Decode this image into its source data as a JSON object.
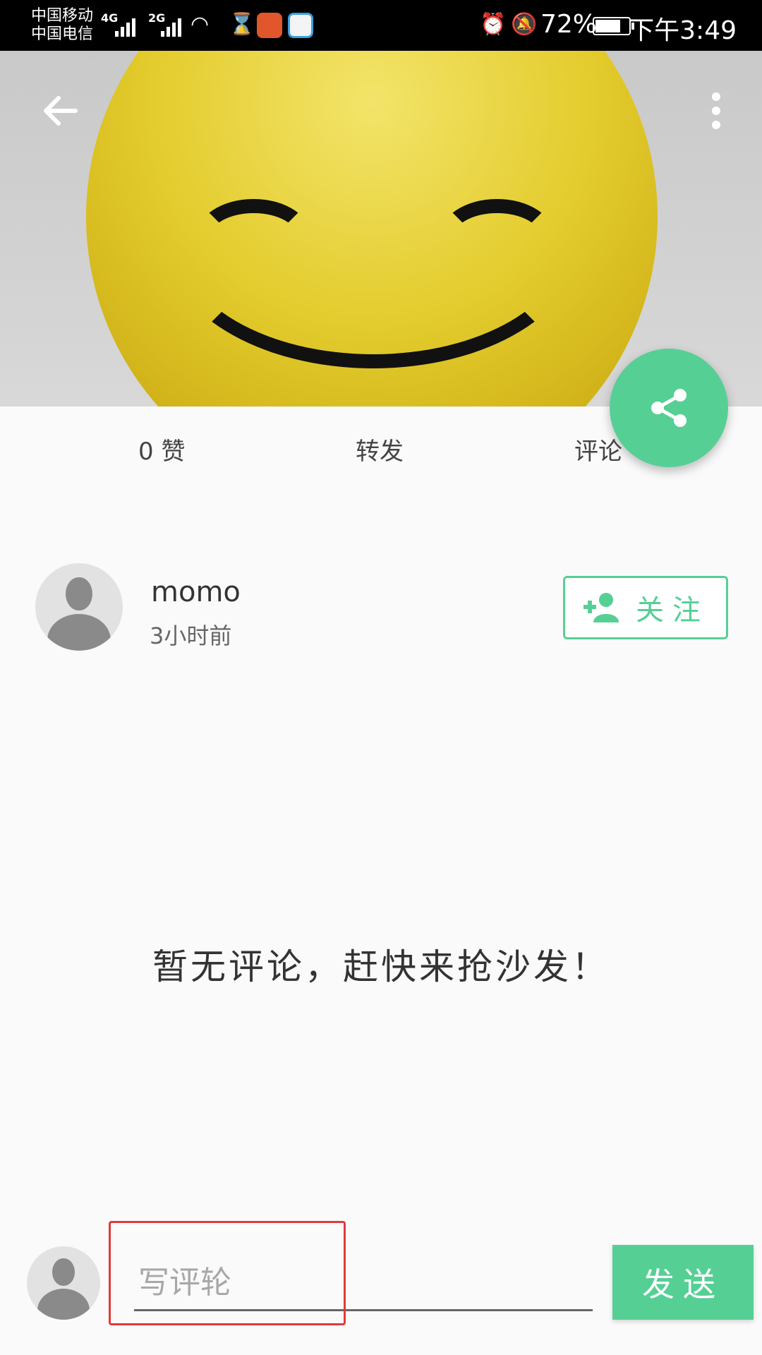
{
  "status_bar": {
    "carrier_1": "中国移动",
    "carrier_2": "中国电信",
    "net_1": "4G",
    "net_2": "2G",
    "battery": "72%",
    "time": "下午3:49"
  },
  "header": {
    "icons": {
      "back": "arrow-left-icon",
      "more": "more-vertical-icon",
      "share": "share-icon"
    }
  },
  "stats": {
    "likes": "0 赞",
    "repost": "转发",
    "comments": "评论"
  },
  "author": {
    "name": "momo",
    "time": "3小时前",
    "follow_label": "关注"
  },
  "comments": {
    "empty_message": "暂无评论，赶快来抢沙发！"
  },
  "composer": {
    "placeholder": "写评轮",
    "send_label": "发送"
  },
  "colors": {
    "accent": "#56cf95",
    "highlight": "#e23a3a"
  }
}
